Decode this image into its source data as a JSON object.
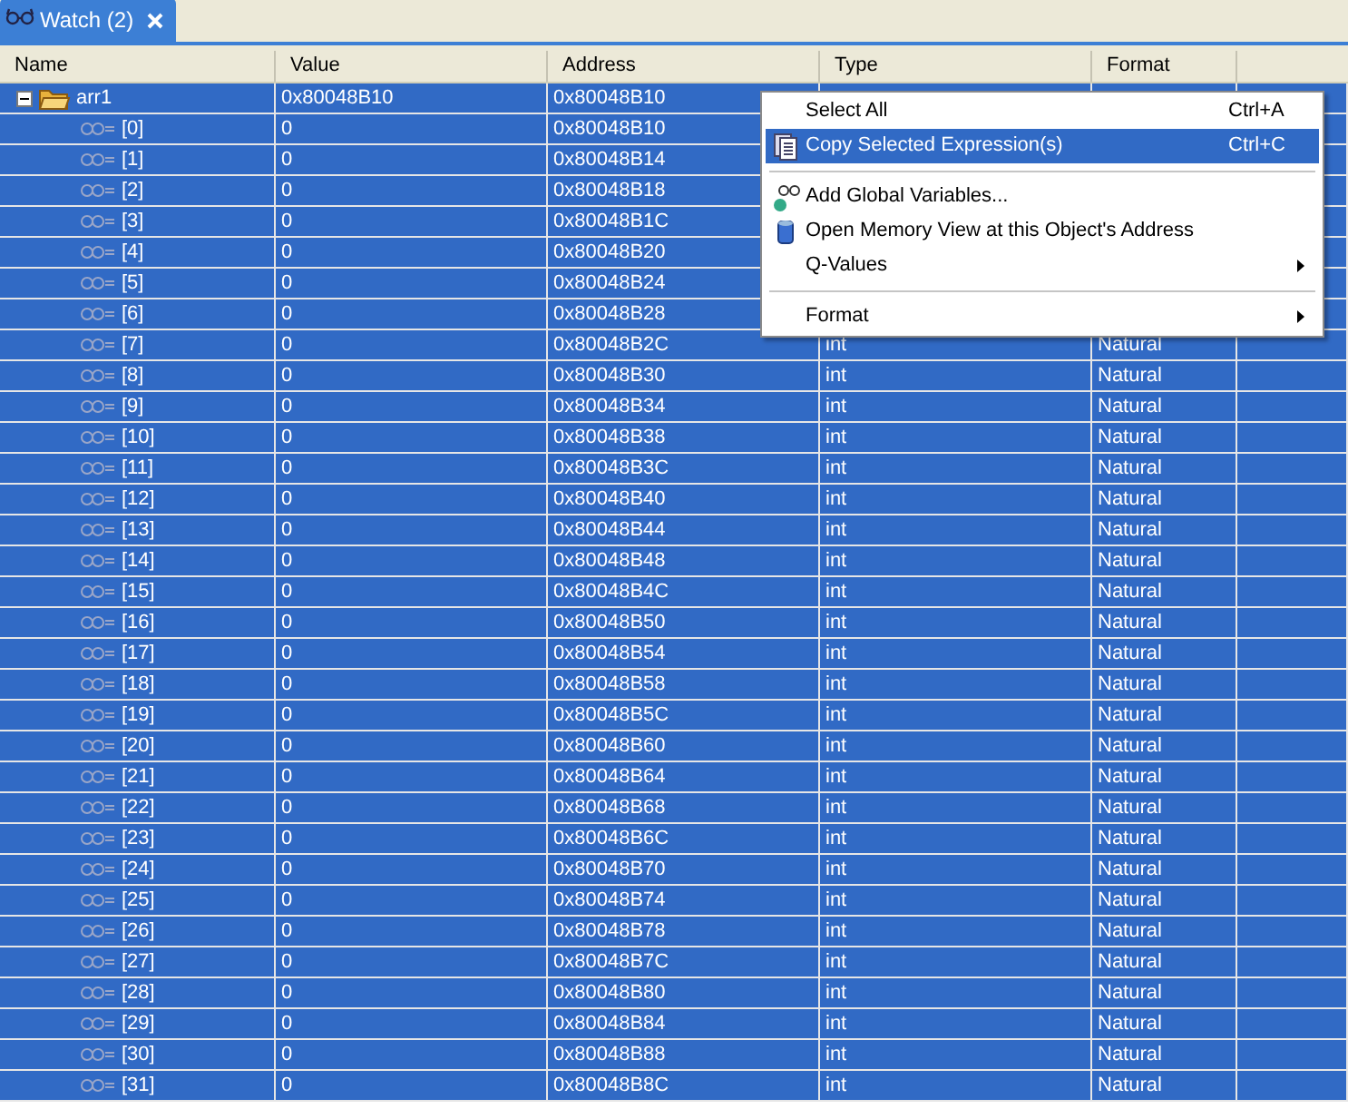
{
  "tab": {
    "title": "Watch (2)",
    "selected": true
  },
  "columns": [
    "Name",
    "Value",
    "Address",
    "Type",
    "Format"
  ],
  "tree": {
    "name": "arr1",
    "value": "0x80048B10",
    "address": "0x80048B10",
    "expanded": true,
    "selected": true,
    "children": [
      {
        "name": "[0]",
        "value": "0",
        "address": "0x80048B10",
        "selected": true
      },
      {
        "name": "[1]",
        "value": "0",
        "address": "0x80048B14",
        "selected": true
      },
      {
        "name": "[2]",
        "value": "0",
        "address": "0x80048B18",
        "selected": true
      },
      {
        "name": "[3]",
        "value": "0",
        "address": "0x80048B1C",
        "selected": true
      },
      {
        "name": "[4]",
        "value": "0",
        "address": "0x80048B20",
        "selected": true
      },
      {
        "name": "[5]",
        "value": "0",
        "address": "0x80048B24",
        "selected": true
      },
      {
        "name": "[6]",
        "value": "0",
        "address": "0x80048B28",
        "selected": true
      },
      {
        "name": "[7]",
        "value": "0",
        "address": "0x80048B2C",
        "type": "int",
        "format": "Natural",
        "selected": true
      },
      {
        "name": "[8]",
        "value": "0",
        "address": "0x80048B30",
        "type": "int",
        "format": "Natural",
        "selected": true
      },
      {
        "name": "[9]",
        "value": "0",
        "address": "0x80048B34",
        "type": "int",
        "format": "Natural",
        "selected": true
      },
      {
        "name": "[10]",
        "value": "0",
        "address": "0x80048B38",
        "type": "int",
        "format": "Natural",
        "selected": true
      },
      {
        "name": "[11]",
        "value": "0",
        "address": "0x80048B3C",
        "type": "int",
        "format": "Natural",
        "selected": true
      },
      {
        "name": "[12]",
        "value": "0",
        "address": "0x80048B40",
        "type": "int",
        "format": "Natural",
        "selected": true
      },
      {
        "name": "[13]",
        "value": "0",
        "address": "0x80048B44",
        "type": "int",
        "format": "Natural",
        "selected": true
      },
      {
        "name": "[14]",
        "value": "0",
        "address": "0x80048B48",
        "type": "int",
        "format": "Natural",
        "selected": true
      },
      {
        "name": "[15]",
        "value": "0",
        "address": "0x80048B4C",
        "type": "int",
        "format": "Natural",
        "selected": true
      },
      {
        "name": "[16]",
        "value": "0",
        "address": "0x80048B50",
        "type": "int",
        "format": "Natural",
        "selected": true
      },
      {
        "name": "[17]",
        "value": "0",
        "address": "0x80048B54",
        "type": "int",
        "format": "Natural",
        "selected": true
      },
      {
        "name": "[18]",
        "value": "0",
        "address": "0x80048B58",
        "type": "int",
        "format": "Natural",
        "selected": true
      },
      {
        "name": "[19]",
        "value": "0",
        "address": "0x80048B5C",
        "type": "int",
        "format": "Natural",
        "selected": true
      },
      {
        "name": "[20]",
        "value": "0",
        "address": "0x80048B60",
        "type": "int",
        "format": "Natural",
        "selected": true
      },
      {
        "name": "[21]",
        "value": "0",
        "address": "0x80048B64",
        "type": "int",
        "format": "Natural",
        "selected": true
      },
      {
        "name": "[22]",
        "value": "0",
        "address": "0x80048B68",
        "type": "int",
        "format": "Natural",
        "selected": true
      },
      {
        "name": "[23]",
        "value": "0",
        "address": "0x80048B6C",
        "type": "int",
        "format": "Natural",
        "selected": true
      },
      {
        "name": "[24]",
        "value": "0",
        "address": "0x80048B70",
        "type": "int",
        "format": "Natural",
        "selected": true
      },
      {
        "name": "[25]",
        "value": "0",
        "address": "0x80048B74",
        "type": "int",
        "format": "Natural",
        "selected": true
      },
      {
        "name": "[26]",
        "value": "0",
        "address": "0x80048B78",
        "type": "int",
        "format": "Natural",
        "selected": true
      },
      {
        "name": "[27]",
        "value": "0",
        "address": "0x80048B7C",
        "type": "int",
        "format": "Natural",
        "selected": true
      },
      {
        "name": "[28]",
        "value": "0",
        "address": "0x80048B80",
        "type": "int",
        "format": "Natural",
        "selected": true
      },
      {
        "name": "[29]",
        "value": "0",
        "address": "0x80048B84",
        "type": "int",
        "format": "Natural",
        "selected": true
      },
      {
        "name": "[30]",
        "value": "0",
        "address": "0x80048B88",
        "type": "int",
        "format": "Natural",
        "selected": true
      },
      {
        "name": "[31]",
        "value": "0",
        "address": "0x80048B8C",
        "type": "int",
        "format": "Natural",
        "selected": true
      }
    ]
  },
  "context_menu": [
    {
      "kind": "item",
      "label": "Select All",
      "shortcut": "Ctrl+A",
      "selected": false
    },
    {
      "kind": "item",
      "label": "Copy Selected Expression(s)",
      "shortcut": "Ctrl+C",
      "selected": true
    },
    {
      "kind": "separator"
    },
    {
      "kind": "item",
      "label": "Add Global Variables...",
      "selected": false
    },
    {
      "kind": "item",
      "label": "Open Memory View at this Object's Address",
      "selected": false
    },
    {
      "kind": "submenu",
      "label": "Q-Values",
      "selected": false
    },
    {
      "kind": "separator"
    },
    {
      "kind": "submenu",
      "label": "Format",
      "selected": false
    }
  ]
}
